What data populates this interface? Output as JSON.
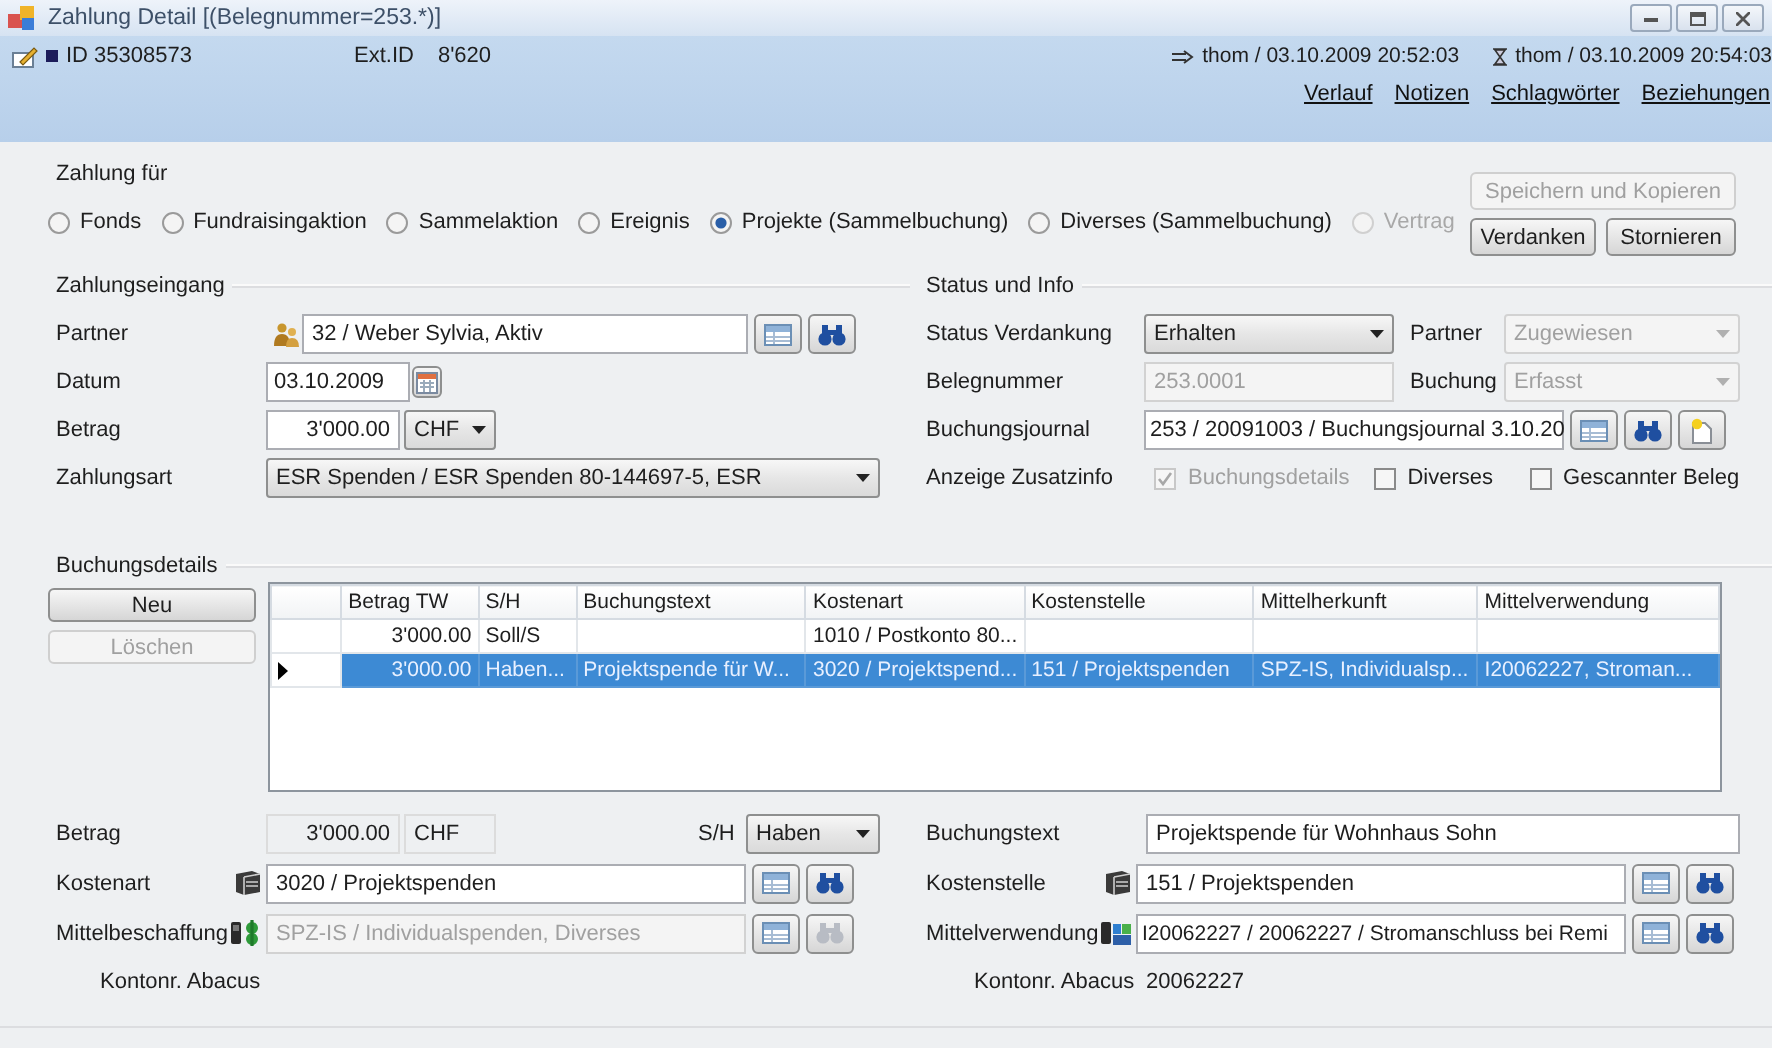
{
  "window": {
    "title": "Zahlung Detail  [(Belegnummer=253.*)]"
  },
  "header": {
    "id": "ID 35308573",
    "ext_id_label": "Ext.ID",
    "ext_id": "8'620",
    "created": "thom / 03.10.2009 20:52:03",
    "modified": "thom / 03.10.2009 20:54:03",
    "links": [
      "Verlauf",
      "Notizen",
      "Schlagwörter",
      "Beziehungen"
    ]
  },
  "zahlung_fuer": {
    "label": "Zahlung für",
    "options": [
      {
        "label": "Fonds",
        "selected": false,
        "disabled": false
      },
      {
        "label": "Fundraisingaktion",
        "selected": false,
        "disabled": false
      },
      {
        "label": "Sammelaktion",
        "selected": false,
        "disabled": false
      },
      {
        "label": "Ereignis",
        "selected": false,
        "disabled": false
      },
      {
        "label": "Projekte (Sammelbuchung)",
        "selected": true,
        "disabled": false
      },
      {
        "label": "Diverses (Sammelbuchung)",
        "selected": false,
        "disabled": false
      },
      {
        "label": "Vertrag",
        "selected": false,
        "disabled": true
      }
    ]
  },
  "actions": [
    {
      "label": "Speichern und Kopieren",
      "disabled": true
    },
    {
      "label": "Verdanken",
      "disabled": false
    },
    {
      "label": "Stornieren",
      "disabled": false
    }
  ],
  "zahlungseingang": {
    "title": "Zahlungseingang",
    "partner": {
      "label": "Partner",
      "value": "32 / Weber Sylvia, Aktiv"
    },
    "datum": {
      "label": "Datum",
      "value": "03.10.2009"
    },
    "betrag": {
      "label": "Betrag",
      "value": "3'000.00",
      "currency": "CHF"
    },
    "zahlungsart": {
      "label": "Zahlungsart",
      "value": "ESR Spenden / ESR Spenden 80-144697-5, ESR"
    }
  },
  "status": {
    "title": "Status und Info",
    "status_verdankung": {
      "label": "Status Verdankung",
      "value": "Erhalten",
      "disabled": false
    },
    "partner": {
      "label": "Partner",
      "value": "Zugewiesen",
      "disabled": true
    },
    "belegnummer": {
      "label": "Belegnummer",
      "value": "253.0001",
      "disabled": true
    },
    "buchung": {
      "label": "Buchung",
      "value": "Erfasst",
      "disabled": true
    },
    "buchungsjournal": {
      "label": "Buchungsjournal",
      "value": "253 / 20091003 / Buchungsjournal 3.10.20"
    },
    "zusatzinfo": {
      "label": "Anzeige Zusatzinfo",
      "options": [
        {
          "label": "Buchungsdetails",
          "checked": true,
          "disabled": true
        },
        {
          "label": "Diverses",
          "checked": false,
          "disabled": false
        },
        {
          "label": "Gescannter Beleg",
          "checked": false,
          "disabled": false
        }
      ]
    }
  },
  "buchungsdetails": {
    "title": "Buchungsdetails",
    "buttons": [
      {
        "label": "Neu",
        "disabled": false
      },
      {
        "label": "Löschen",
        "disabled": true
      }
    ],
    "table": {
      "columns": [
        "Betrag TW",
        "S/H",
        "Buchungstext",
        "Kostenart",
        "Kostenstelle",
        "Mittelherkunft",
        "Mittelverwendung"
      ],
      "rows": [
        {
          "selected": false,
          "current": false,
          "cells": [
            "3'000.00",
            "Soll/S",
            null,
            "1010 / Postkonto 80...",
            null,
            null,
            null
          ]
        },
        {
          "selected": true,
          "current": true,
          "cells": [
            "3'000.00",
            "Haben...",
            "Projektspende für W...",
            "3020 / Projektspend...",
            "151 / Projektspenden",
            "SPZ-IS, Individualsp...",
            "I20062227, Stroman..."
          ]
        }
      ]
    }
  },
  "buchung": {
    "betrag": {
      "label": "Betrag",
      "value": "3'000.00",
      "currency": "CHF"
    },
    "sh": {
      "label": "S/H",
      "value": "Haben"
    },
    "buchungstext": {
      "label": "Buchungstext",
      "value": "Projektspende für Wohnhaus Sohn"
    },
    "kostenart": {
      "label": "Kostenart",
      "value": "3020 / Projektspenden",
      "disabled": false
    },
    "kostenstelle": {
      "label": "Kostenstelle",
      "value": "151 / Projektspenden",
      "disabled": false
    },
    "mittelbeschaffung": {
      "label": "Mittelbeschaffung",
      "value": "SPZ-IS / Individualspenden, Diverses",
      "disabled": true
    },
    "mittelverwendung": {
      "label": "Mittelverwendung",
      "value": "I20062227 / 20062227 / Stromanschluss bei Remi",
      "disabled": false
    },
    "kontonr_left": {
      "label": "Kontonr. Abacus"
    },
    "kontonr_right": {
      "label": "Kontonr. Abacus",
      "value": "20062227"
    }
  }
}
